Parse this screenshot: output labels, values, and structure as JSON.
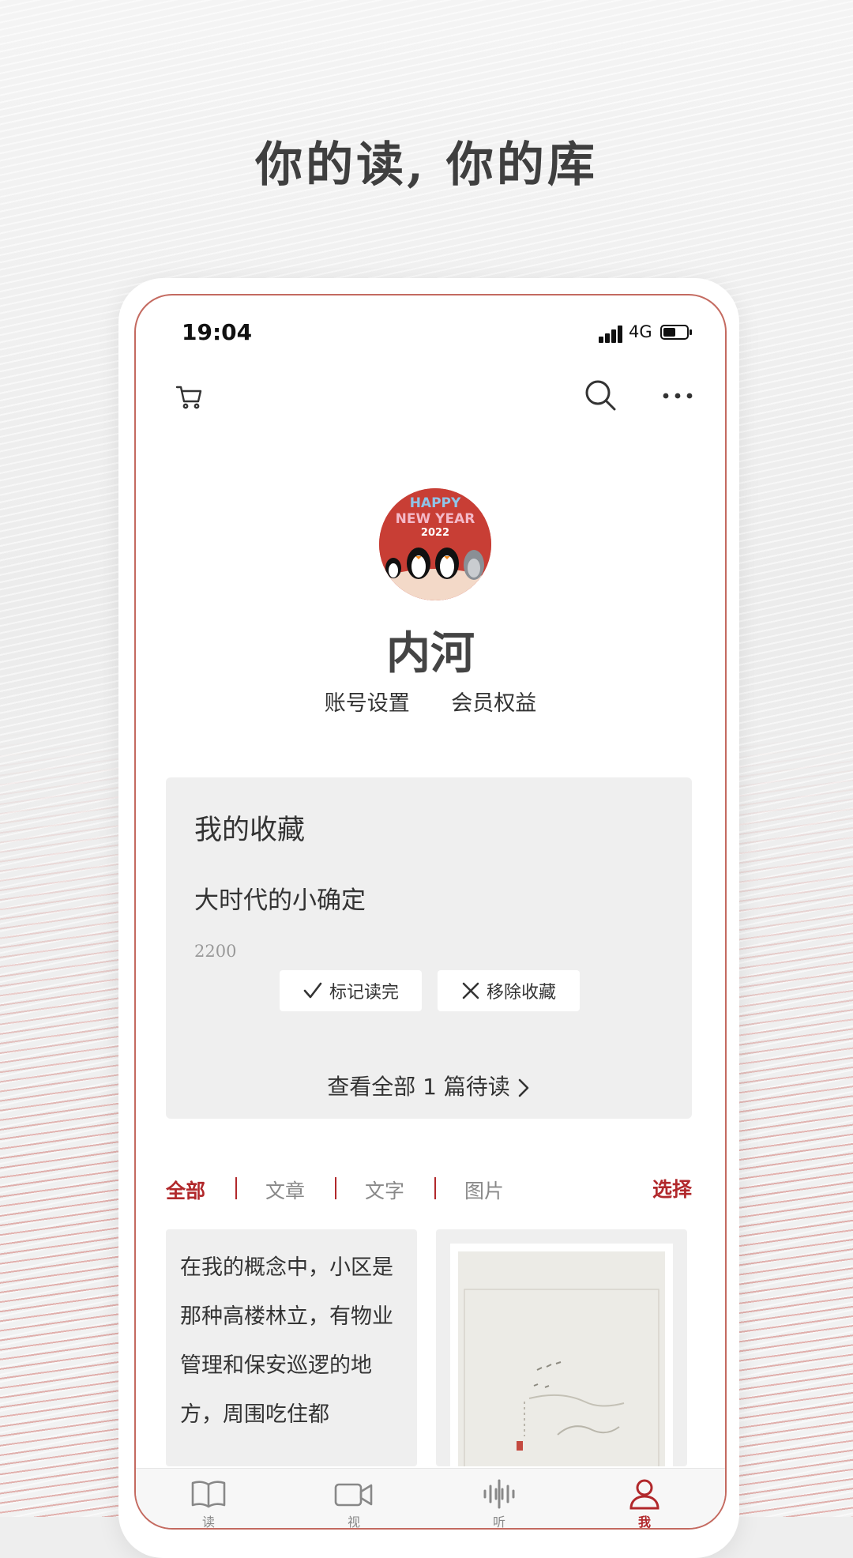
{
  "headline": "你的读, 你的库",
  "status_bar": {
    "time": "19:04",
    "network": "4G"
  },
  "topbar": {
    "cart_icon": "cart-icon",
    "search_icon": "search-icon",
    "more_icon": "more-dots-icon"
  },
  "profile": {
    "avatar_text_line1": "HAPPY",
    "avatar_text_line2": "NEW YEAR",
    "avatar_text_line3": "2022",
    "name": "内河",
    "account_settings": "账号设置",
    "member_benefits": "会员权益"
  },
  "favorites": {
    "title": "我的收藏",
    "article_title": "大时代的小确定",
    "count": "2200",
    "mark_read": "标记读完",
    "remove": "移除收藏",
    "view_all": "查看全部 1 篇待读"
  },
  "filters": {
    "all": "全部",
    "articles": "文章",
    "text": "文字",
    "images": "图片",
    "select": "选择"
  },
  "cards": {
    "text_excerpt": "在我的概念中，小区是那种高楼林立，有物业管理和保安巡逻的地方，周围吃住都"
  },
  "tabbar": {
    "read": "读",
    "watch": "视",
    "listen": "听",
    "me": "我"
  },
  "colors": {
    "accent": "#b1282b",
    "frame": "#c46a60"
  }
}
